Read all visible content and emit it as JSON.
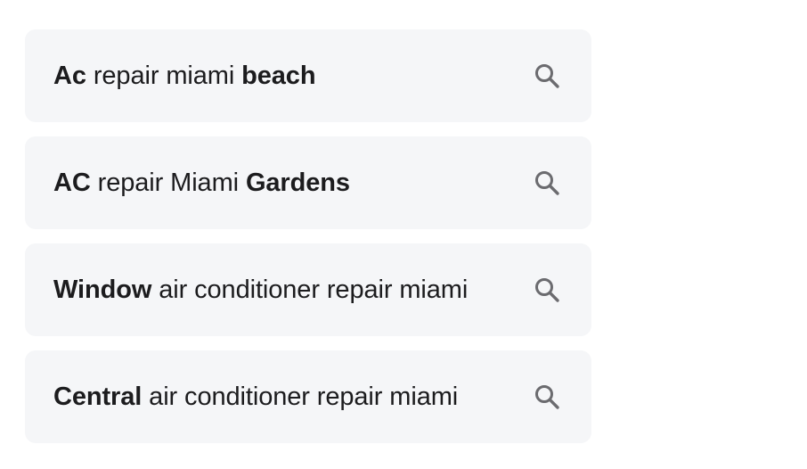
{
  "suggestions": [
    {
      "bold_prefix": "Ac",
      "text": " repair miami ",
      "bold_suffix": "beach",
      "icon": "search-icon"
    },
    {
      "bold_prefix": "AC",
      "text": " repair Miami ",
      "bold_suffix": "Gardens",
      "icon": "search-icon"
    },
    {
      "bold_prefix": "Window",
      "text": " air conditioner repair miami",
      "bold_suffix": "",
      "icon": "search-icon"
    },
    {
      "bold_prefix": "Central",
      "text": " air conditioner repair miami",
      "bold_suffix": "",
      "icon": "search-icon"
    }
  ],
  "colors": {
    "card_background": "#f5f6f8",
    "text": "#1c1c1e",
    "icon": "#6b6b6f"
  }
}
